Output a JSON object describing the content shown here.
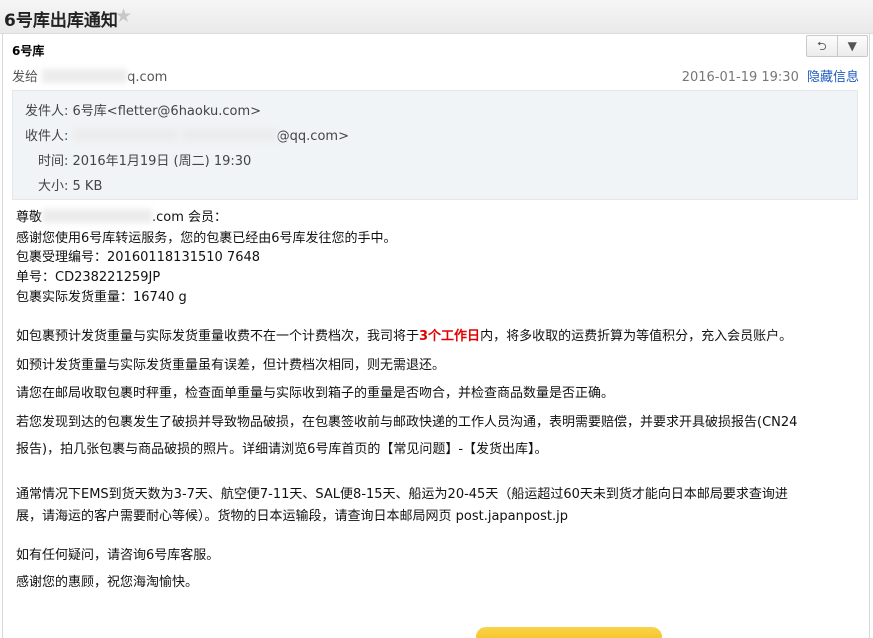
{
  "header": {
    "title": "6号库出库通知",
    "star_icon": "star-icon"
  },
  "message": {
    "sender_name": "6号库",
    "to_label": "发给",
    "to_suffix": "q.com",
    "date": "2016-01-19 19:30",
    "hide_info": "隐藏信息",
    "toolbar": {
      "reply_icon": "reply-arrow-icon",
      "menu_icon": "chevron-down-icon",
      "reply_glyph": "⮌",
      "menu_glyph": "▼"
    }
  },
  "details": {
    "from_label": "发件人:",
    "from_value": "6号库<fletter@6haoku.com>",
    "to_label": "收件人:",
    "to_suffix": "@qq.com>",
    "time_label": "时间:",
    "time_value": "2016年1月19日 (周二) 19:30",
    "size_label": "大小:",
    "size_value": "5 KB"
  },
  "body": {
    "greeting_prefix": "尊敬",
    "greeting_suffix": ".com 会员：",
    "thanks": "感谢您使用6号库转运服务，您的包裹已经由6号库发往您的手中。",
    "package_no": "包裹受理编号：20160118131510 7648",
    "tracking_no": "单号：CD238221259JP",
    "weight": "包裹实际发货重量：16740 g",
    "p1_a": "如包裹预计发货重量与实际发货重量收费不在一个计费档次，我司将于",
    "p1_red": "3个工作日",
    "p1_b": "内，将多收取的运费折算为等值积分，充入会员账户。",
    "p2": "如预计发货重量与实际发货重量虽有误差，但计费档次相同，则无需退还。",
    "p3": "请您在邮局收取包裹时秤重，检查面单重量与实际收到箱子的重量是否吻合，并检查商品数量是否正确。",
    "p4_line1": "若您发现到达的包裹发生了破损并导致物品破损，在包裹签收前与邮政快递的工作人员沟通，表明需要赔偿，并要求开具破损报告(CN24",
    "p4_line2": "报告)，拍几张包裹与商品破损的照片。详细请浏览6号库首页的【常见问题】-【发货出库】。",
    "p5_line1": "通常情况下EMS到货天数为3-7天、航空便7-11天、SAL便8-15天、船运为20-45天（船运超过60天未到货才能向日本邮局要求查询进",
    "p5_line2": "展，请海运的客户需要耐心等候）。货物的日本运输段，请查询日本邮局网页 post.japanpost.jp",
    "p6": "如有任何疑问，请咨询6号库客服。",
    "p7": "感谢您的惠顾，祝您海淘愉快。"
  }
}
